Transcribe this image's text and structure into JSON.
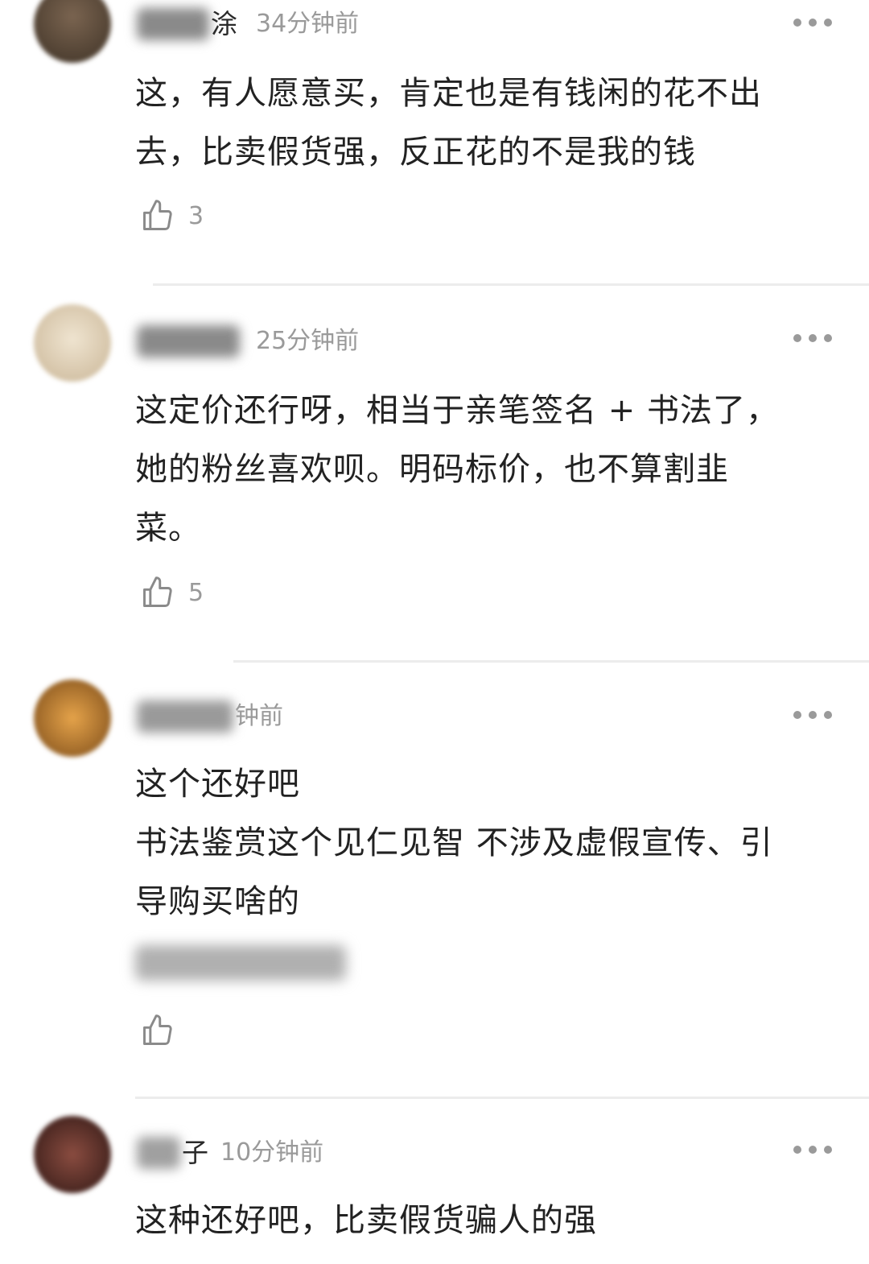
{
  "colors": {
    "text": "#222222",
    "meta": "#9a9a9a",
    "divider": "#ececec",
    "background": "#ffffff"
  },
  "comments": [
    {
      "name_visible": "涂",
      "time": "34分钟前",
      "lines": [
        "这，有人愿意买，肯定也是有钱闲的花不出",
        "去，比卖假货强，反正花的不是我的钱"
      ],
      "likes": "3",
      "avatar_color": "#5a4a3a"
    },
    {
      "name_visible": "",
      "time": "25分钟前",
      "lines": [
        "这定价还行呀，相当于亲笔签名 + 书法了，",
        "她的粉丝喜欢呗。明码标价，也不算割韭",
        "菜。"
      ],
      "likes": "5",
      "avatar_color": "#d8c9b0"
    },
    {
      "name_visible": "",
      "time": "钟前",
      "lines": [
        "这个还好吧",
        "书法鉴赏这个见仁见智 不涉及虚假宣传、引",
        "导购买啥的"
      ],
      "likes": "",
      "avatar_color": "#b8762a"
    },
    {
      "name_visible": "子",
      "time": "10分钟前",
      "lines": [
        "这种还好吧，比卖假货骗人的强"
      ],
      "likes": "",
      "avatar_color": "#6a3a34"
    }
  ]
}
